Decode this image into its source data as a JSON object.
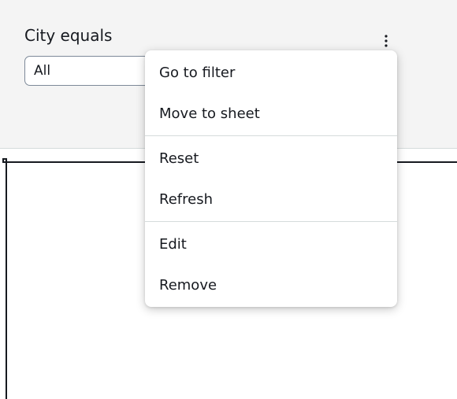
{
  "filter": {
    "title": "City equals",
    "selected_value": "All",
    "menu_icon": "vertical-ellipsis-icon"
  },
  "context_menu": {
    "groups": [
      {
        "items": [
          {
            "label": "Go to filter"
          },
          {
            "label": "Move to sheet"
          }
        ]
      },
      {
        "items": [
          {
            "label": "Reset"
          },
          {
            "label": "Refresh"
          }
        ]
      },
      {
        "items": [
          {
            "label": "Edit"
          },
          {
            "label": "Remove"
          }
        ]
      }
    ]
  },
  "colors": {
    "panel_background": "#f4f4f4",
    "text": "#16191f",
    "divider": "#d5dbdb",
    "menu_background": "#ffffff"
  }
}
